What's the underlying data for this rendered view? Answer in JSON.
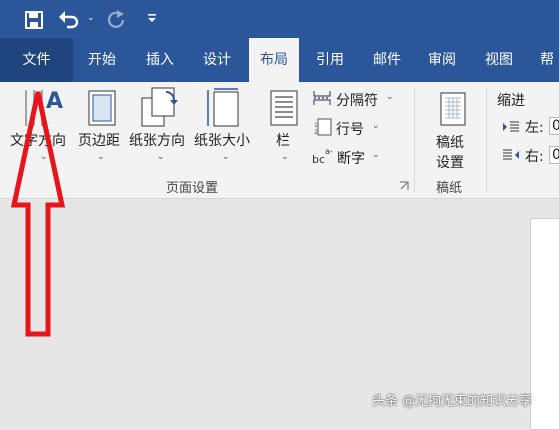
{
  "qat": {
    "save_icon": "save-icon",
    "undo_icon": "undo-icon",
    "redo_icon": "redo-icon",
    "customize_icon": "customize-qat-icon"
  },
  "tabs": [
    {
      "label": "文件"
    },
    {
      "label": "开始"
    },
    {
      "label": "插入"
    },
    {
      "label": "设计"
    },
    {
      "label": "布局"
    },
    {
      "label": "引用"
    },
    {
      "label": "邮件"
    },
    {
      "label": "审阅"
    },
    {
      "label": "视图"
    },
    {
      "label": "帮"
    }
  ],
  "ribbon": {
    "page_setup": {
      "text_direction": "文字方向",
      "margins": "页边距",
      "orientation": "纸张方向",
      "size": "纸张大小",
      "columns": "栏",
      "breaks": "分隔符",
      "line_numbers": "行号",
      "hyphenation": "断字",
      "group_label": "页面设置"
    },
    "manuscript": {
      "button_line1": "稿纸",
      "button_line2": "设置",
      "group_label": "稿纸"
    },
    "indent": {
      "title": "缩进",
      "left_label": "左:",
      "left_value": "0",
      "right_label": "右:",
      "right_value": "0"
    }
  },
  "watermark": "头条 @无拘无束的知识分享",
  "colors": {
    "ribbon_blue": "#2b579a",
    "file_tab": "#1f447e",
    "arrow_red": "#e8141c"
  }
}
